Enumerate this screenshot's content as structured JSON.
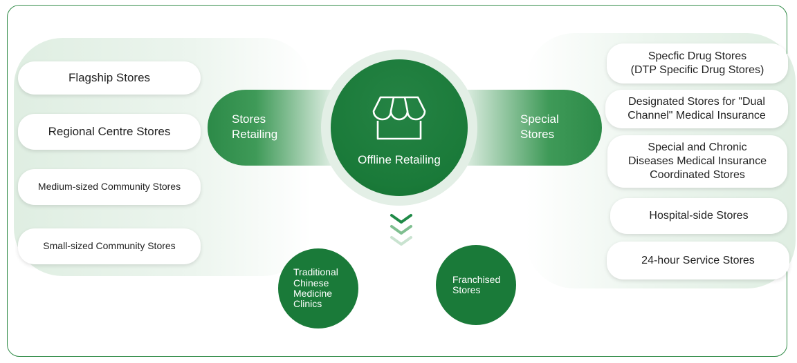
{
  "center": {
    "label": "Offline Retailing",
    "icon": "store-awning-icon"
  },
  "left_band": {
    "label": "Stores\nRetailing"
  },
  "right_band": {
    "label": "Special\nStores"
  },
  "left_items": [
    "Flagship Stores",
    "Regional Centre Stores",
    "Medium-sized Community Stores",
    "Small-sized Community Stores"
  ],
  "right_items": [
    "Specfic Drug Stores\n(DTP Specific Drug Stores)",
    "Designated Stores for \"Dual\nChannel\" Medical Insurance",
    "Special and Chronic\nDiseases Medical Insurance\nCoordinated Stores",
    "Hospital-side Stores",
    "24-hour Service Stores"
  ],
  "bottom_items": [
    "Traditional\nChinese\nMedicine\nClinics",
    "Franchised\nStores"
  ],
  "colors": {
    "primary": "#1a7a39",
    "light": "#e3efe6",
    "border": "#2f8a46"
  }
}
